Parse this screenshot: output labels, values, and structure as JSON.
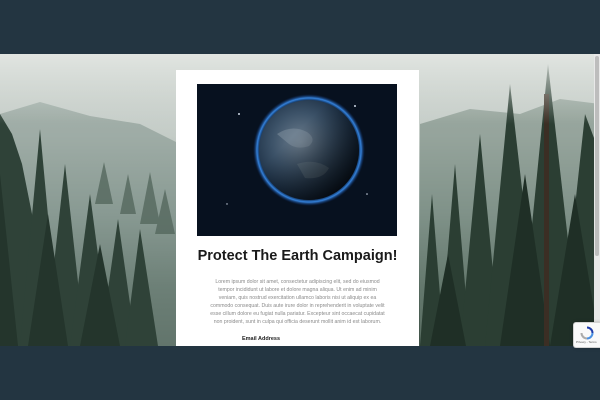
{
  "campaign": {
    "title": "Protect The Earth Campaign!",
    "body": "Lorem ipsum dolor sit amet, consectetur adipiscing elit, sed do eiusmod tempor incididunt ut labore et dolore magna aliqua. Ut enim ad minim veniam, quis nostrud exercitation ullamco laboris nisi ut aliquip ex ea commodo consequat. Duis aute irure dolor in reprehenderit in voluptate velit esse cillum dolore eu fugiat nulla pariatur. Excepteur sint occaecat cupidatat non proident, sunt in culpa qui officia deserunt mollit anim id est laborum.",
    "hero_image": "earth-from-space",
    "email_label": "Email Address",
    "email_value": ""
  },
  "background": {
    "scene": "misty-pine-forest",
    "frame_color": "#233541"
  },
  "recaptcha": {
    "icon": "recaptcha-icon",
    "footer": "Privacy - Terms"
  }
}
